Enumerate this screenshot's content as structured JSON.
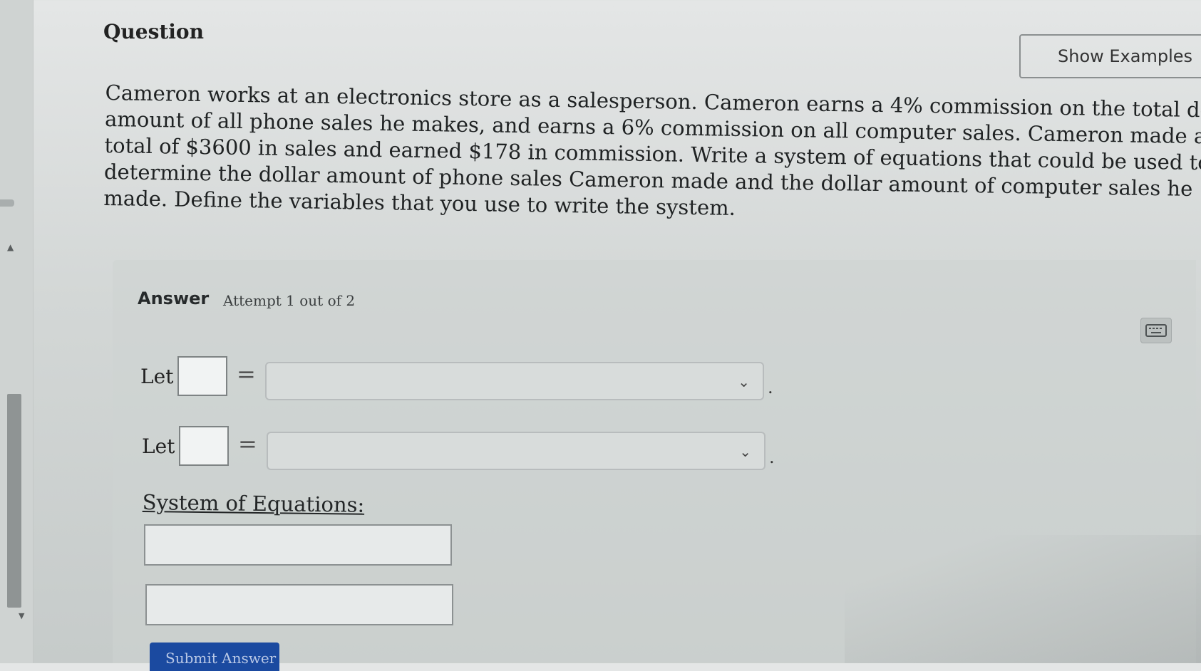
{
  "question": {
    "title": "Question",
    "show_examples_label": "Show Examples",
    "text_lines": [
      "Cameron works at an electronics store as a salesperson. Cameron earns a 4% commission on the total dollar",
      "amount of all phone sales he makes, and earns a 6% commission on all computer sales. Cameron made a",
      "total of $3600 in sales and earned $178 in commission. Write a system of equations that could be used to",
      "determine the dollar amount of phone sales Cameron made and the dollar amount of computer sales he",
      "made. Define the variables that you use to write the system."
    ]
  },
  "answer": {
    "heading": "Answer",
    "attempt": "Attempt 1 out of 2",
    "keyboard_icon": "keyboard-icon",
    "let_rows": [
      {
        "label": "Let",
        "variable": "",
        "equals": "=",
        "selected": "",
        "period": "."
      },
      {
        "label": "Let",
        "variable": "",
        "equals": "=",
        "selected": "",
        "period": "."
      }
    ],
    "system_label": "System of Equations:",
    "equations": [
      "",
      ""
    ],
    "submit_label": "Submit Answer"
  },
  "colors": {
    "submit_bg": "#1b4aa0",
    "background": "#d3d7d6"
  }
}
